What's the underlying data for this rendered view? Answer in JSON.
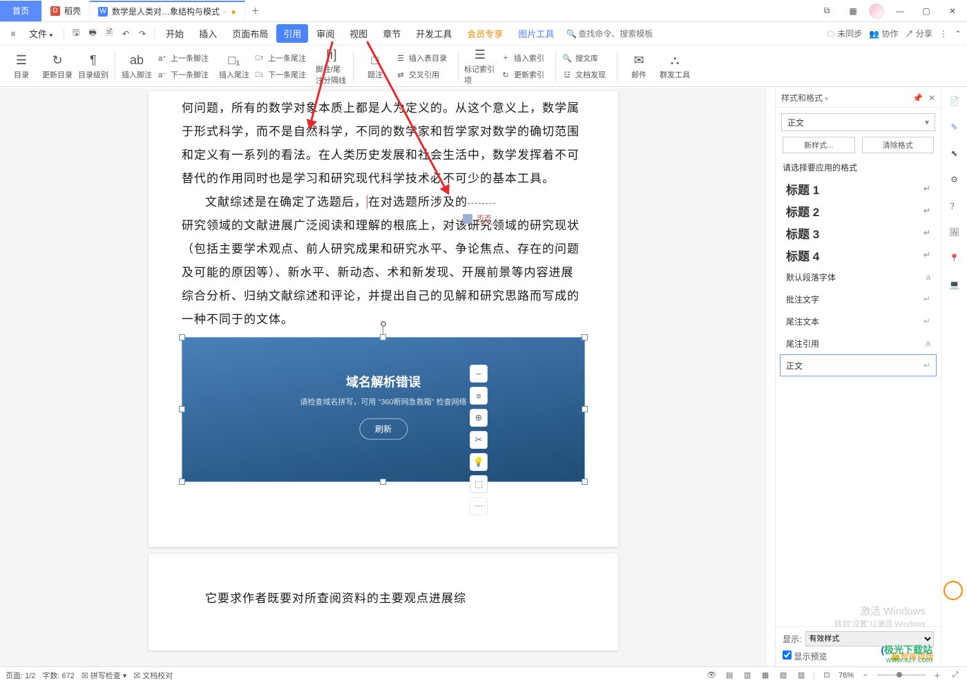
{
  "titlebar": {
    "home": "首页",
    "daoke": "稻壳",
    "doc_tab": "数学是人类对…象结构与模式",
    "add": "＋",
    "icons": {
      "grid1": "⧉",
      "grid2": "▦"
    }
  },
  "menu": {
    "file": "文件",
    "items": [
      "开始",
      "插入",
      "页面布局",
      "引用",
      "审阅",
      "视图",
      "章节",
      "开发工具",
      "会员专享",
      "图片工具"
    ],
    "active_index": 3,
    "orange_index": 8,
    "blue_index": 9,
    "search_ph": "查找命令、搜索模板",
    "right": {
      "unsync": "未同步",
      "coop": "协作",
      "share": "分享"
    }
  },
  "ribbon": {
    "group1": [
      {
        "ico": "☰",
        "label": "目录"
      },
      {
        "ico": "↻",
        "label": "更新目录"
      },
      {
        "ico": "¶",
        "label": "目录级别"
      }
    ],
    "group2_big": {
      "ico": "ab",
      "label": "插入脚注"
    },
    "group2_rows": [
      {
        "ico": "a⁺",
        "label": "上一条脚注"
      },
      {
        "ico": "a⁻",
        "label": "下一条脚注"
      }
    ],
    "group3_big": {
      "ico": "□₁",
      "label": "插入尾注"
    },
    "group3_rows": [
      {
        "ico": "□↑",
        "label": "上一条尾注"
      },
      {
        "ico": "□↓",
        "label": "下一条尾注"
      }
    ],
    "footsep": {
      "ico": "[ı]",
      "label": "脚注/尾注分隔线"
    },
    "caption_big": {
      "ico": "□",
      "label": "题注"
    },
    "caption_rows": [
      {
        "ico": "☰",
        "label": "插入表目录"
      },
      {
        "ico": "⇄",
        "label": "交叉引用"
      }
    ],
    "index_big": {
      "ico": "☰",
      "label": "标记索引项"
    },
    "index_rows": [
      {
        "ico": "+",
        "label": "插入索引"
      },
      {
        "ico": "↻",
        "label": "更新索引"
      }
    ],
    "biblio_rows": [
      {
        "ico": "🔍",
        "label": "搜文库"
      },
      {
        "ico": "☳",
        "label": "文档发现"
      }
    ],
    "mail_big": {
      "ico": "✉",
      "label": "邮件"
    },
    "group_big": {
      "ico": "⛬",
      "label": "群发工具"
    }
  },
  "document": {
    "p1": "何问题，所有的数学对象本质上都是人为定义的。从这个意义上，数学属于形式科学，而不是自然科学，不同的数学家和哲学家对数学的确切范围和定义有一系列的看法。在人类历史发展和社会生活中，数学发挥着不可替代的作用同时也是学习和研究现代科学技术必不可少的基本工具。",
    "p2a": "文献综述是在确定了选题后，",
    "p2b": "在对选题所涉及的",
    "p2c": "研究领域的文献进展广泛阅读和理解的根底上，对该研究领域的研究现状（包括主要学术观点、前人研究成果和研究水平、争论焦点、存在的问题及可能的原因等）、新水平、新动态、术和新发现、开展前景等内容进展综合分析、归纳文献综述和评论，并提出自己的见解和研究思路而写成的一种不同于的文体。",
    "imgbox": {
      "title": "域名解析错误",
      "sub": "请检查域名拼写，可用 \"360断网急救箱\" 检查网络",
      "btn": "刷新"
    },
    "p3": "它要求作者既要对所查阅资料的主要观点进展综",
    "comment_label": "否否",
    "float": [
      "−",
      "≡",
      "⊕",
      "✂",
      "💡",
      "⬚",
      "⋯"
    ]
  },
  "sidepanel": {
    "title": "样式和格式",
    "dropdown": "正文",
    "btn_new": "新样式...",
    "btn_clear": "清除格式",
    "prompt": "请选择要应用的格式",
    "items": [
      {
        "label": "标题 1",
        "big": true,
        "mark": "↵"
      },
      {
        "label": "标题 2",
        "big": true,
        "mark": "↵"
      },
      {
        "label": "标题 3",
        "big": true,
        "mark": "↵"
      },
      {
        "label": "标题 4",
        "big": true,
        "mark": "↵"
      },
      {
        "label": "默认段落字体",
        "big": false,
        "mark": "a"
      },
      {
        "label": "批注文字",
        "big": false,
        "mark": "↵"
      },
      {
        "label": "尾注文本",
        "big": false,
        "mark": "↵"
      },
      {
        "label": "尾注引用",
        "big": false,
        "mark": "a"
      },
      {
        "label": "正文",
        "big": false,
        "mark": "↵",
        "sel": true
      }
    ],
    "show_label": "显示:",
    "show_value": "有效样式",
    "preview": "显示预览",
    "ai_typeset": "智能排版"
  },
  "statusbar": {
    "page": "页面: 1/2",
    "words": "字数: 672",
    "spell": "拼写检查",
    "proof": "文档校对",
    "zoom": "76%"
  },
  "watermark": {
    "line1": "极光下载站",
    "line2": "www.xz7.com"
  },
  "activate": {
    "t": "激活 Windows",
    "s": "转到“设置”以激活 Windows"
  }
}
